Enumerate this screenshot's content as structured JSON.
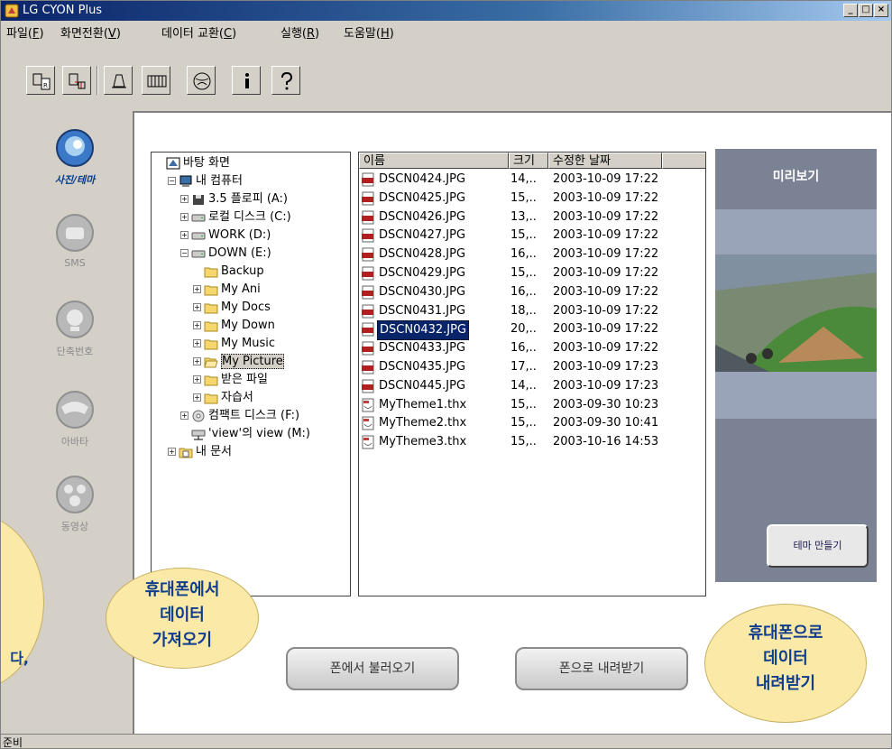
{
  "window": {
    "title": "LG CYON Plus",
    "minimize": "_",
    "maximize": "□",
    "close": "×"
  },
  "menu": [
    {
      "label": "파일(",
      "key": "F",
      "end": ")"
    },
    {
      "label": "화면전환(",
      "key": "V",
      "end": ")"
    },
    {
      "label": "데이터 교환(",
      "key": "C",
      "end": ")"
    },
    {
      "label": "실행(",
      "key": "R",
      "end": ")"
    },
    {
      "label": "도움말(",
      "key": "H",
      "end": ")"
    }
  ],
  "toolbar_icons": [
    "exchange-left-icon",
    "exchange-right-icon",
    "bell-icon",
    "keyboard-icon",
    "globe-icon",
    "info-icon",
    "help-icon"
  ],
  "nav": [
    {
      "label": "사진/테마",
      "icon": "photo-theme-icon",
      "active": true
    },
    {
      "label": "SMS",
      "icon": "sms-icon",
      "active": false
    },
    {
      "label": "단축번호",
      "icon": "speed-dial-icon",
      "active": false
    },
    {
      "label": "아바타",
      "icon": "avatar-icon",
      "active": false
    },
    {
      "label": "동영상",
      "icon": "video-icon",
      "active": false
    }
  ],
  "tree": [
    {
      "label": "바탕 화면",
      "icon": "desktop-icon",
      "depth": 0,
      "exp": ""
    },
    {
      "label": "내 컴퓨터",
      "icon": "computer-icon",
      "depth": 1,
      "exp": "−"
    },
    {
      "label": "3.5 플로피 (A:)",
      "icon": "floppy-icon",
      "depth": 2,
      "exp": "+"
    },
    {
      "label": "로컬 디스크 (C:)",
      "icon": "drive-icon",
      "depth": 2,
      "exp": "+"
    },
    {
      "label": "WORK (D:)",
      "icon": "drive-icon",
      "depth": 2,
      "exp": "+"
    },
    {
      "label": "DOWN (E:)",
      "icon": "drive-icon",
      "depth": 2,
      "exp": "−"
    },
    {
      "label": "Backup",
      "icon": "folder-icon",
      "depth": 3,
      "exp": ""
    },
    {
      "label": "My Ani",
      "icon": "folder-icon",
      "depth": 3,
      "exp": "+"
    },
    {
      "label": "My Docs",
      "icon": "folder-icon",
      "depth": 3,
      "exp": "+"
    },
    {
      "label": "My Down",
      "icon": "folder-icon",
      "depth": 3,
      "exp": "+"
    },
    {
      "label": "My Music",
      "icon": "folder-icon",
      "depth": 3,
      "exp": "+"
    },
    {
      "label": "My Picture",
      "icon": "folder-open-icon",
      "depth": 3,
      "exp": "+",
      "selected": true
    },
    {
      "label": "받은 파일",
      "icon": "folder-icon",
      "depth": 3,
      "exp": "+"
    },
    {
      "label": "자습서",
      "icon": "folder-icon",
      "depth": 3,
      "exp": "+"
    },
    {
      "label": "컴팩트 디스크 (F:)",
      "icon": "cd-icon",
      "depth": 2,
      "exp": "+"
    },
    {
      "label": "'view'의 view (M:)",
      "icon": "network-drive-icon",
      "depth": 2,
      "exp": ""
    },
    {
      "label": "내 문서",
      "icon": "my-documents-icon",
      "depth": 1,
      "exp": "+"
    }
  ],
  "files": {
    "columns": [
      "이름",
      "크기",
      "수정한 날짜"
    ],
    "rows": [
      {
        "name": "DSCN0424.JPG",
        "size": "14,..",
        "date": "2003-10-09 17:22",
        "type": "jpg"
      },
      {
        "name": "DSCN0425.JPG",
        "size": "15,..",
        "date": "2003-10-09 17:22",
        "type": "jpg"
      },
      {
        "name": "DSCN0426.JPG",
        "size": "13,..",
        "date": "2003-10-09 17:22",
        "type": "jpg"
      },
      {
        "name": "DSCN0427.JPG",
        "size": "15,..",
        "date": "2003-10-09 17:22",
        "type": "jpg"
      },
      {
        "name": "DSCN0428.JPG",
        "size": "16,..",
        "date": "2003-10-09 17:22",
        "type": "jpg"
      },
      {
        "name": "DSCN0429.JPG",
        "size": "15,..",
        "date": "2003-10-09 17:22",
        "type": "jpg"
      },
      {
        "name": "DSCN0430.JPG",
        "size": "16,..",
        "date": "2003-10-09 17:22",
        "type": "jpg"
      },
      {
        "name": "DSCN0431.JPG",
        "size": "18,..",
        "date": "2003-10-09 17:22",
        "type": "jpg"
      },
      {
        "name": "DSCN0432.JPG",
        "size": "20,..",
        "date": "2003-10-09 17:22",
        "type": "jpg",
        "selected": true
      },
      {
        "name": "DSCN0433.JPG",
        "size": "16,..",
        "date": "2003-10-09 17:22",
        "type": "jpg"
      },
      {
        "name": "DSCN0435.JPG",
        "size": "17,..",
        "date": "2003-10-09 17:23",
        "type": "jpg"
      },
      {
        "name": "DSCN0445.JPG",
        "size": "14,..",
        "date": "2003-10-09 17:23",
        "type": "jpg"
      },
      {
        "name": "MyTheme1.thx",
        "size": "15,..",
        "date": "2003-09-30 10:23",
        "type": "thx"
      },
      {
        "name": "MyTheme2.thx",
        "size": "15,..",
        "date": "2003-09-30 10:41",
        "type": "thx"
      },
      {
        "name": "MyTheme3.thx",
        "size": "15,..",
        "date": "2003-10-16 14:53",
        "type": "thx"
      }
    ]
  },
  "preview": {
    "title": "미리보기",
    "theme_button": "테마 만들기"
  },
  "actions": {
    "from_phone": "폰에서 불러오기",
    "to_phone": "폰으로 내려받기"
  },
  "status": "준비",
  "callouts": {
    "left_fragment": "다,",
    "from_phone_lines": [
      "휴대폰에서",
      "데이터",
      "가져오기"
    ],
    "to_phone_lines": [
      "휴대폰으로",
      "데이터",
      "내려받기"
    ]
  },
  "colors": {
    "title_bar": "#0a246a",
    "selection": "#0a246a",
    "preview_bg": "#7a8294",
    "callout_bg": "#fbe9a8",
    "callout_text": "#0f3d8c"
  }
}
